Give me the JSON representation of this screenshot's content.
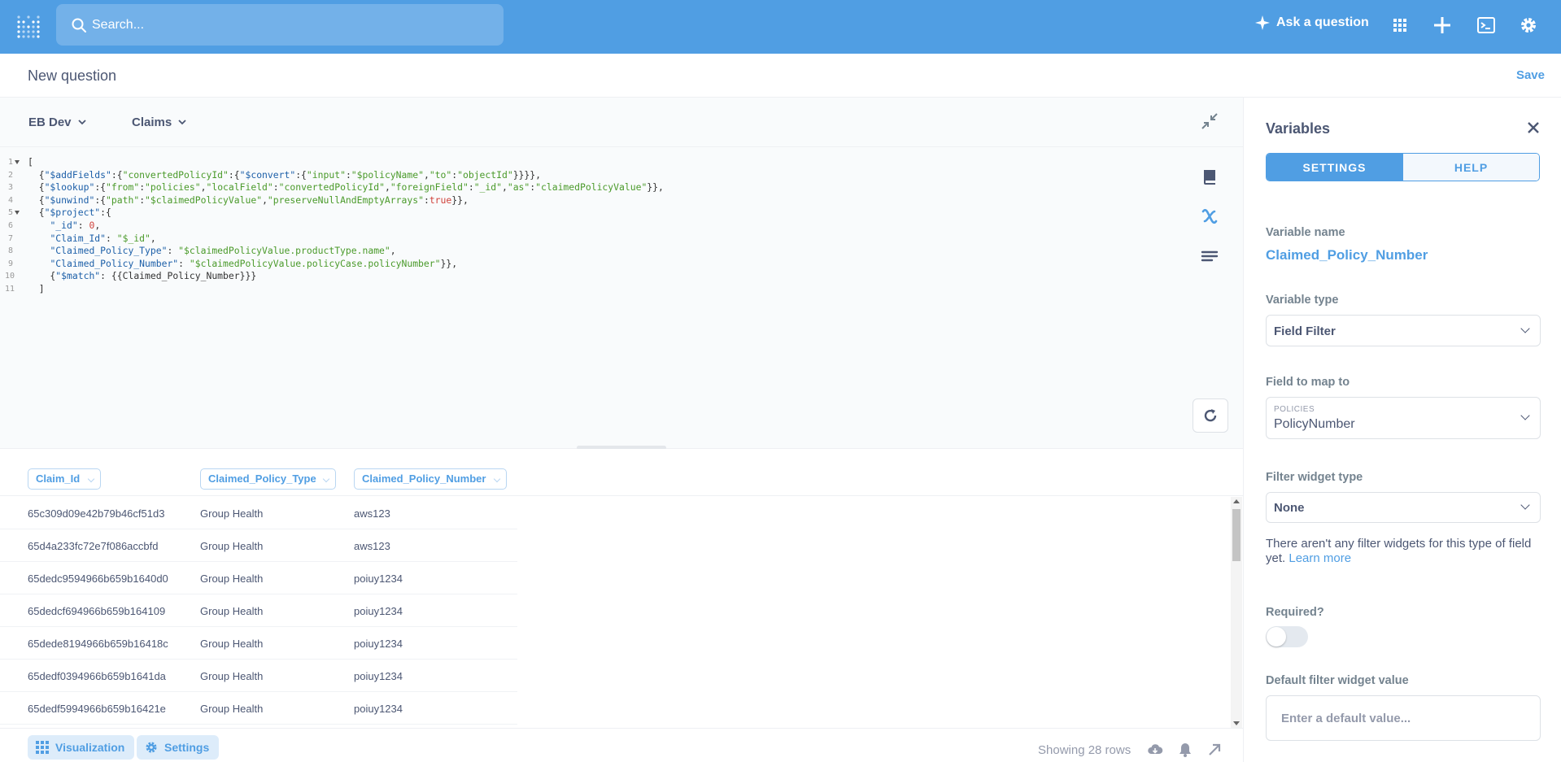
{
  "topnav": {
    "search_placeholder": "Search...",
    "ask_label": "Ask a question"
  },
  "header": {
    "title": "New question",
    "save_label": "Save"
  },
  "editor": {
    "database": "EB Dev",
    "collection": "Claims",
    "lines": [
      {
        "n": "1",
        "fold": true,
        "segs": [
          [
            "p",
            "["
          ]
        ]
      },
      {
        "n": "2",
        "fold": false,
        "segs": [
          [
            "p",
            "  {"
          ],
          [
            "k",
            "\"$addFields\""
          ],
          [
            "p",
            ":{"
          ],
          [
            "s",
            "\"convertedPolicyId\""
          ],
          [
            "p",
            ":{"
          ],
          [
            "k",
            "\"$convert\""
          ],
          [
            "p",
            ":{"
          ],
          [
            "s",
            "\"input\""
          ],
          [
            "p",
            ":"
          ],
          [
            "s",
            "\"$policyName\""
          ],
          [
            "p",
            ","
          ],
          [
            "s",
            "\"to\""
          ],
          [
            "p",
            ":"
          ],
          [
            "s",
            "\"objectId\""
          ],
          [
            "p",
            "}}}},"
          ]
        ]
      },
      {
        "n": "3",
        "fold": false,
        "segs": [
          [
            "p",
            "  {"
          ],
          [
            "k",
            "\"$lookup\""
          ],
          [
            "p",
            ":{"
          ],
          [
            "s",
            "\"from\""
          ],
          [
            "p",
            ":"
          ],
          [
            "s",
            "\"policies\""
          ],
          [
            "p",
            ","
          ],
          [
            "s",
            "\"localField\""
          ],
          [
            "p",
            ":"
          ],
          [
            "s",
            "\"convertedPolicyId\""
          ],
          [
            "p",
            ","
          ],
          [
            "s",
            "\"foreignField\""
          ],
          [
            "p",
            ":"
          ],
          [
            "s",
            "\"_id\""
          ],
          [
            "p",
            ","
          ],
          [
            "s",
            "\"as\""
          ],
          [
            "p",
            ":"
          ],
          [
            "s",
            "\"claimedPolicyValue\""
          ],
          [
            "p",
            "}},"
          ]
        ]
      },
      {
        "n": "4",
        "fold": false,
        "segs": [
          [
            "p",
            "  {"
          ],
          [
            "k",
            "\"$unwind\""
          ],
          [
            "p",
            ":{"
          ],
          [
            "s",
            "\"path\""
          ],
          [
            "p",
            ":"
          ],
          [
            "s",
            "\"$claimedPolicyValue\""
          ],
          [
            "p",
            ","
          ],
          [
            "s",
            "\"preserveNullAndEmptyArrays\""
          ],
          [
            "p",
            ":"
          ],
          [
            "n",
            "true"
          ],
          [
            "p",
            "}},"
          ]
        ]
      },
      {
        "n": "5",
        "fold": true,
        "segs": [
          [
            "p",
            "  {"
          ],
          [
            "k",
            "\"$project\""
          ],
          [
            "p",
            ":{"
          ]
        ]
      },
      {
        "n": "6",
        "fold": false,
        "segs": [
          [
            "p",
            "    "
          ],
          [
            "k",
            "\"_id\""
          ],
          [
            "p",
            ": "
          ],
          [
            "n",
            "0"
          ],
          [
            "p",
            ","
          ]
        ]
      },
      {
        "n": "7",
        "fold": false,
        "segs": [
          [
            "p",
            "    "
          ],
          [
            "k",
            "\"Claim_Id\""
          ],
          [
            "p",
            ": "
          ],
          [
            "s",
            "\"$_id\""
          ],
          [
            "p",
            ","
          ]
        ]
      },
      {
        "n": "8",
        "fold": false,
        "segs": [
          [
            "p",
            "    "
          ],
          [
            "k",
            "\"Claimed_Policy_Type\""
          ],
          [
            "p",
            ": "
          ],
          [
            "s",
            "\"$claimedPolicyValue.productType.name\""
          ],
          [
            "p",
            ","
          ]
        ]
      },
      {
        "n": "9",
        "fold": false,
        "segs": [
          [
            "p",
            "    "
          ],
          [
            "k",
            "\"Claimed_Policy_Number\""
          ],
          [
            "p",
            ": "
          ],
          [
            "s",
            "\"$claimedPolicyValue.policyCase.policyNumber\""
          ],
          [
            "p",
            "}},"
          ]
        ]
      },
      {
        "n": "10",
        "fold": false,
        "segs": [
          [
            "p",
            "    {"
          ],
          [
            "k",
            "\"$match\""
          ],
          [
            "p",
            ": {{Claimed_Policy_Number}}}"
          ]
        ]
      },
      {
        "n": "11",
        "fold": false,
        "segs": [
          [
            "p",
            "  ]"
          ]
        ]
      }
    ]
  },
  "results": {
    "columns": [
      "Claim_Id",
      "Claimed_Policy_Type",
      "Claimed_Policy_Number"
    ],
    "rows": [
      [
        "65c309d09e42b79b46cf51d3",
        "Group Health",
        "aws123"
      ],
      [
        "65d4a233fc72e7f086accbfd",
        "Group Health",
        "aws123"
      ],
      [
        "65dedc9594966b659b1640d0",
        "Group Health",
        "poiuy1234"
      ],
      [
        "65dedcf694966b659b164109",
        "Group Health",
        "poiuy1234"
      ],
      [
        "65dede8194966b659b16418c",
        "Group Health",
        "poiuy1234"
      ],
      [
        "65dedf0394966b659b1641da",
        "Group Health",
        "poiuy1234"
      ],
      [
        "65dedf5994966b659b16421e",
        "Group Health",
        "poiuy1234"
      ]
    ]
  },
  "footer": {
    "visualization_label": "Visualization",
    "settings_label": "Settings",
    "rows_text": "Showing 28 rows"
  },
  "variables": {
    "title": "Variables",
    "tab_settings": "SETTINGS",
    "tab_help": "HELP",
    "name_label": "Variable name",
    "name_value": "Claimed_Policy_Number",
    "type_label": "Variable type",
    "type_value": "Field Filter",
    "field_label": "Field to map to",
    "field_table": "POLICIES",
    "field_value": "PolicyNumber",
    "widget_label": "Filter widget type",
    "widget_value": "None",
    "help_text": "There aren't any filter widgets for this type of field yet.",
    "learn_more": "Learn more",
    "required_label": "Required?",
    "required_on": false,
    "default_label": "Default filter widget value",
    "default_placeholder": "Enter a default value..."
  },
  "colors": {
    "brand": "#509ee3",
    "text": "#4c5773"
  }
}
